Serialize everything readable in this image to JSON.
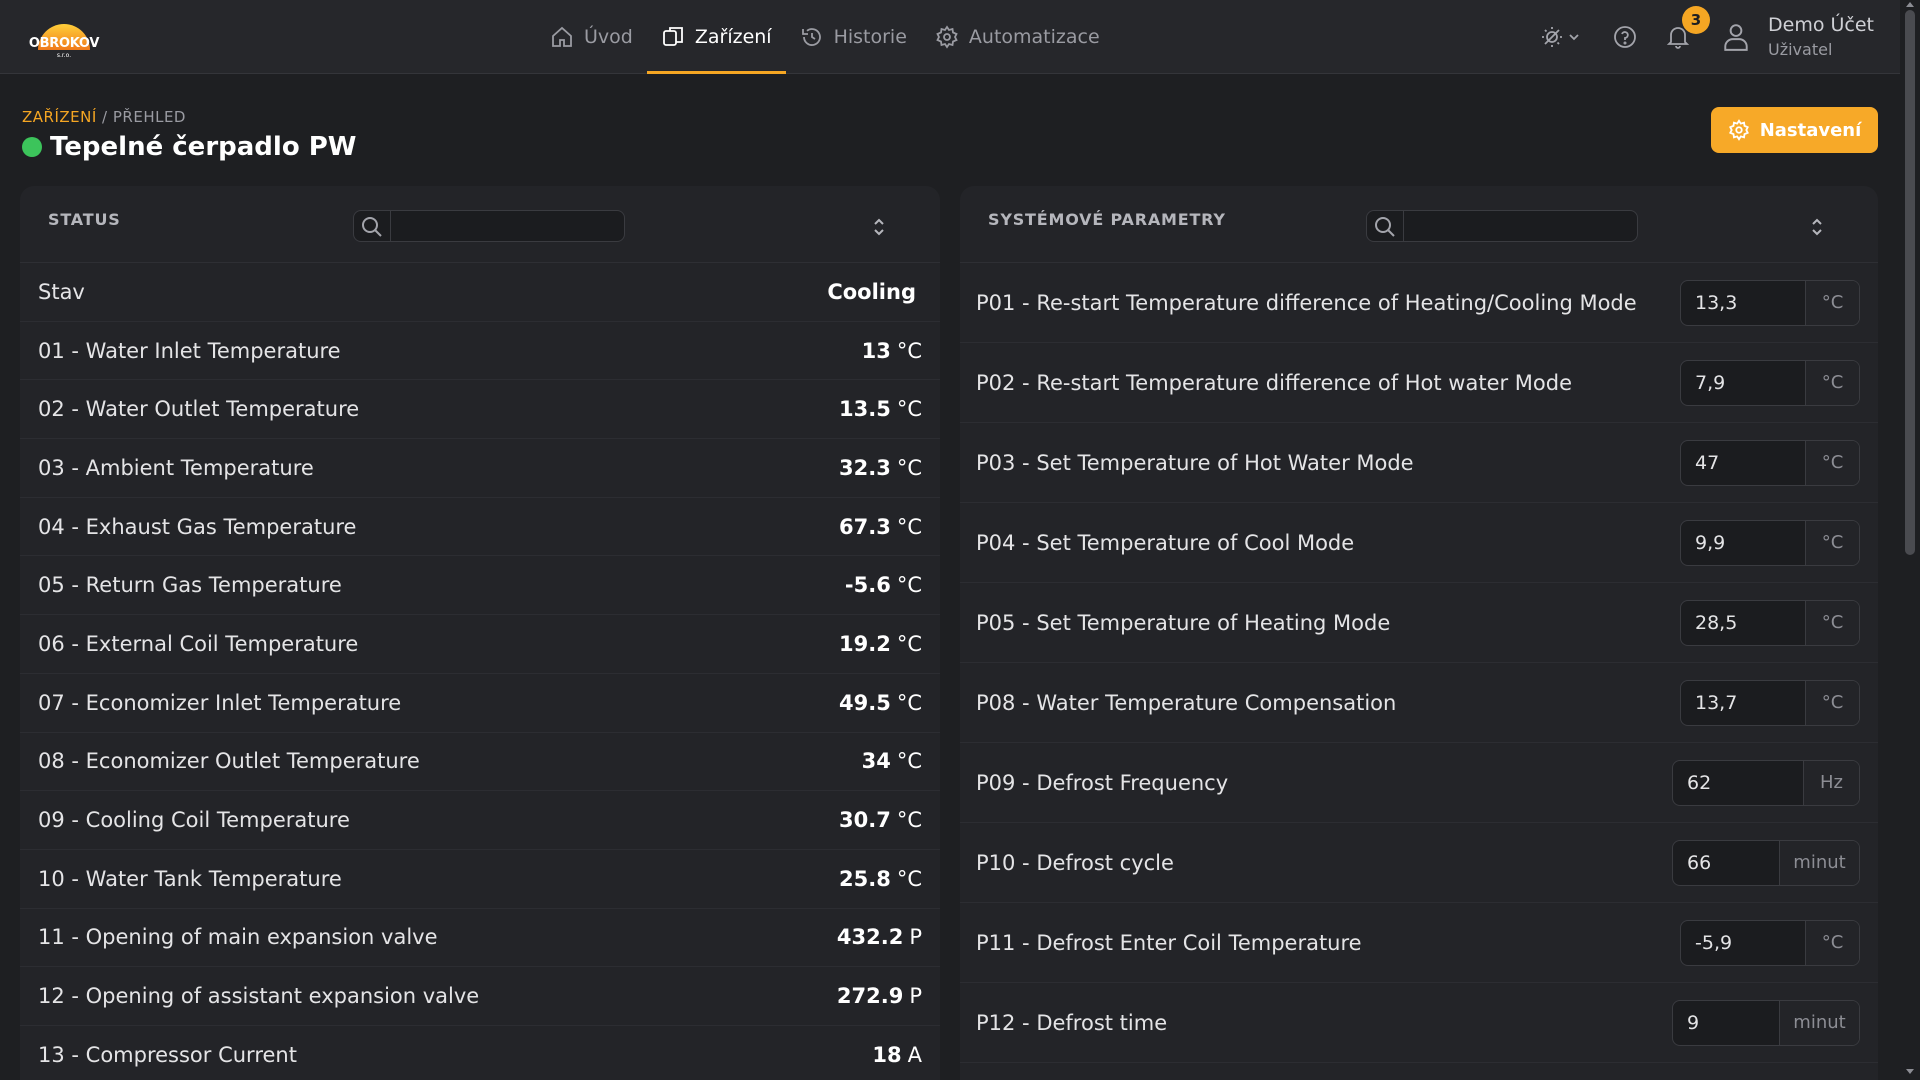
{
  "brand": {
    "name": "OBROKOV",
    "sub": "s.r.o."
  },
  "nav": [
    {
      "label": "Úvod",
      "icon": "home-icon"
    },
    {
      "label": "Zařízení",
      "icon": "devices-icon",
      "active": true
    },
    {
      "label": "Historie",
      "icon": "history-icon"
    },
    {
      "label": "Automatizace",
      "icon": "gear-icon"
    }
  ],
  "header": {
    "notification_count": "3",
    "user_name": "Demo Účet",
    "user_role": "Uživatel"
  },
  "breadcrumb": {
    "section": "ZAŘÍZENÍ",
    "separator": " / ",
    "page": "PŘEHLED"
  },
  "page_title": "Tepelné čerpadlo PW",
  "settings_label": "Nastavení",
  "status_panel": {
    "title": "STATUS",
    "search_placeholder": "",
    "rows": [
      {
        "label": "Stav",
        "value": "Cooling",
        "unit": ""
      },
      {
        "label": "01 - Water Inlet Temperature",
        "value": "13",
        "unit": "°C"
      },
      {
        "label": "02 - Water Outlet Temperature",
        "value": "13.5",
        "unit": "°C"
      },
      {
        "label": "03 - Ambient Temperature",
        "value": "32.3",
        "unit": "°C"
      },
      {
        "label": "04 - Exhaust Gas Temperature",
        "value": "67.3",
        "unit": "°C"
      },
      {
        "label": "05 - Return Gas Temperature",
        "value": "-5.6",
        "unit": "°C"
      },
      {
        "label": "06 - External Coil Temperature",
        "value": "19.2",
        "unit": "°C"
      },
      {
        "label": "07 - Economizer Inlet Temperature",
        "value": "49.5",
        "unit": "°C"
      },
      {
        "label": "08 - Economizer Outlet Temperature",
        "value": "34",
        "unit": "°C"
      },
      {
        "label": "09 - Cooling Coil Temperature",
        "value": "30.7",
        "unit": "°C"
      },
      {
        "label": "10 - Water Tank Temperature",
        "value": "25.8",
        "unit": "°C"
      },
      {
        "label": "11 - Opening of main expansion valve",
        "value": "432.2",
        "unit": "P"
      },
      {
        "label": "12 - Opening of assistant expansion valve",
        "value": "272.9",
        "unit": "P"
      },
      {
        "label": "13 - Compressor Current",
        "value": "18",
        "unit": "A"
      }
    ]
  },
  "params_panel": {
    "title": "SYSTÉMOVÉ PARAMETRY",
    "search_placeholder": "",
    "rows": [
      {
        "label": "P01 - Re-start Temperature difference of Heating/Cooling Mode",
        "value": "13,3",
        "unit": "°C"
      },
      {
        "label": "P02 - Re-start Temperature difference of Hot water Mode",
        "value": "7,9",
        "unit": "°C"
      },
      {
        "label": "P03 - Set Temperature of Hot Water Mode",
        "value": "47",
        "unit": "°C"
      },
      {
        "label": "P04 - Set Temperature of Cool Mode",
        "value": "9,9",
        "unit": "°C"
      },
      {
        "label": "P05 - Set Temperature of Heating Mode",
        "value": "28,5",
        "unit": "°C"
      },
      {
        "label": "P08 - Water Temperature Compensation",
        "value": "13,7",
        "unit": "°C"
      },
      {
        "label": "P09 - Defrost Frequency",
        "value": "62",
        "unit": "Hz"
      },
      {
        "label": "P10 - Defrost cycle",
        "value": "66",
        "unit": "minut"
      },
      {
        "label": "P11 - Defrost Enter Coil Temperature",
        "value": "-5,9",
        "unit": "°C"
      },
      {
        "label": "P12 - Defrost time",
        "value": "9",
        "unit": "minut"
      }
    ]
  },
  "colors": {
    "accent": "#f5a623",
    "status_ok": "#3cc45b",
    "background": "#1e1f22",
    "panel": "#232428"
  }
}
